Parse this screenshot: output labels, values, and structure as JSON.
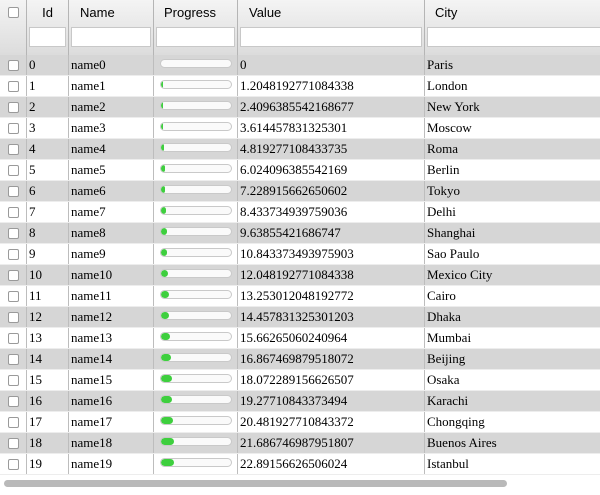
{
  "columns": {
    "id": "Id",
    "name": "Name",
    "progress": "Progress",
    "value": "Value",
    "city": "City"
  },
  "rows": [
    {
      "id": "0",
      "name": "name0",
      "progress": 0.0,
      "value": "0",
      "city": "Paris"
    },
    {
      "id": "1",
      "name": "name1",
      "progress": 0.01,
      "value": "1.2048192771084338",
      "city": "London"
    },
    {
      "id": "2",
      "name": "name2",
      "progress": 0.02,
      "value": "2.4096385542168677",
      "city": "New York"
    },
    {
      "id": "3",
      "name": "name3",
      "progress": 0.03,
      "value": "3.614457831325301",
      "city": "Moscow"
    },
    {
      "id": "4",
      "name": "name4",
      "progress": 0.04,
      "value": "4.819277108433735",
      "city": "Roma"
    },
    {
      "id": "5",
      "name": "name5",
      "progress": 0.05,
      "value": "6.024096385542169",
      "city": "Berlin"
    },
    {
      "id": "6",
      "name": "name6",
      "progress": 0.06,
      "value": "7.228915662650602",
      "city": "Tokyo"
    },
    {
      "id": "7",
      "name": "name7",
      "progress": 0.07,
      "value": "8.433734939759036",
      "city": "Delhi"
    },
    {
      "id": "8",
      "name": "name8",
      "progress": 0.08,
      "value": "9.63855421686747",
      "city": "Shanghai"
    },
    {
      "id": "9",
      "name": "name9",
      "progress": 0.09,
      "value": "10.843373493975903",
      "city": "Sao Paulo"
    },
    {
      "id": "10",
      "name": "name10",
      "progress": 0.1,
      "value": "12.048192771084338",
      "city": "Mexico City"
    },
    {
      "id": "11",
      "name": "name11",
      "progress": 0.11,
      "value": "13.253012048192772",
      "city": "Cairo"
    },
    {
      "id": "12",
      "name": "name12",
      "progress": 0.12,
      "value": "14.457831325301203",
      "city": "Dhaka"
    },
    {
      "id": "13",
      "name": "name13",
      "progress": 0.13,
      "value": "15.66265060240964",
      "city": "Mumbai"
    },
    {
      "id": "14",
      "name": "name14",
      "progress": 0.14,
      "value": "16.867469879518072",
      "city": "Beijing"
    },
    {
      "id": "15",
      "name": "name15",
      "progress": 0.15,
      "value": "18.072289156626507",
      "city": "Osaka"
    },
    {
      "id": "16",
      "name": "name16",
      "progress": 0.16,
      "value": "19.27710843373494",
      "city": "Karachi"
    },
    {
      "id": "17",
      "name": "name17",
      "progress": 0.17,
      "value": "20.481927710843372",
      "city": "Chongqing"
    },
    {
      "id": "18",
      "name": "name18",
      "progress": 0.18,
      "value": "21.686746987951807",
      "city": "Buenos Aires"
    },
    {
      "id": "19",
      "name": "name19",
      "progress": 0.19,
      "value": "22.89156626506024",
      "city": "Istanbul"
    }
  ],
  "colors": {
    "progress_fill": "#3ecf3e",
    "odd_row": "#d6d6d6",
    "even_row": "#ffffff"
  }
}
